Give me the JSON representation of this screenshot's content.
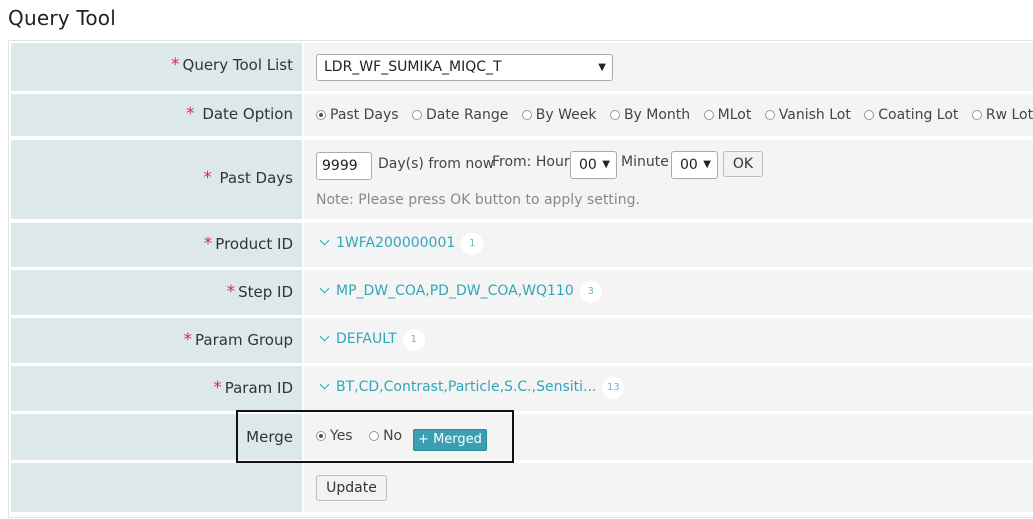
{
  "page": {
    "title": "Query Tool"
  },
  "form": {
    "query_tool_list": {
      "label": "Query Tool List",
      "value": "LDR_WF_SUMIKA_MIQC_T"
    },
    "date_option": {
      "label": "Date Option",
      "options": [
        "Past Days",
        "Date Range",
        "By Week",
        "By Month",
        "MLot",
        "Vanish Lot",
        "Coating Lot",
        "Rw Lot"
      ],
      "selected": "Past Days"
    },
    "past_days": {
      "label": "Past Days",
      "value": "9999",
      "suffix": "Day(s) from now",
      "from_hour_label": "From: Hour",
      "hour_value": "00",
      "minute_label": "Minute",
      "minute_value": "00",
      "ok_label": "OK",
      "note": "Note: Please press OK button to apply setting."
    },
    "product_id": {
      "label": "Product ID",
      "value": "1WFA200000001",
      "count": "1"
    },
    "step_id": {
      "label": "Step ID",
      "value": "MP_DW_COA,PD_DW_COA,WQ110",
      "count": "3"
    },
    "param_group": {
      "label": "Param Group",
      "value": "DEFAULT",
      "count": "1"
    },
    "param_id": {
      "label": "Param ID",
      "value": "BT,CD,Contrast,Particle,S.C.,Sensiti...",
      "count": "13"
    },
    "merge": {
      "label": "Merge",
      "yes_label": "Yes",
      "no_label": "No",
      "selected": "Yes",
      "merged_button": "Merged",
      "merged_icon": "+"
    },
    "update_label": "Update",
    "required_mark": "*"
  }
}
